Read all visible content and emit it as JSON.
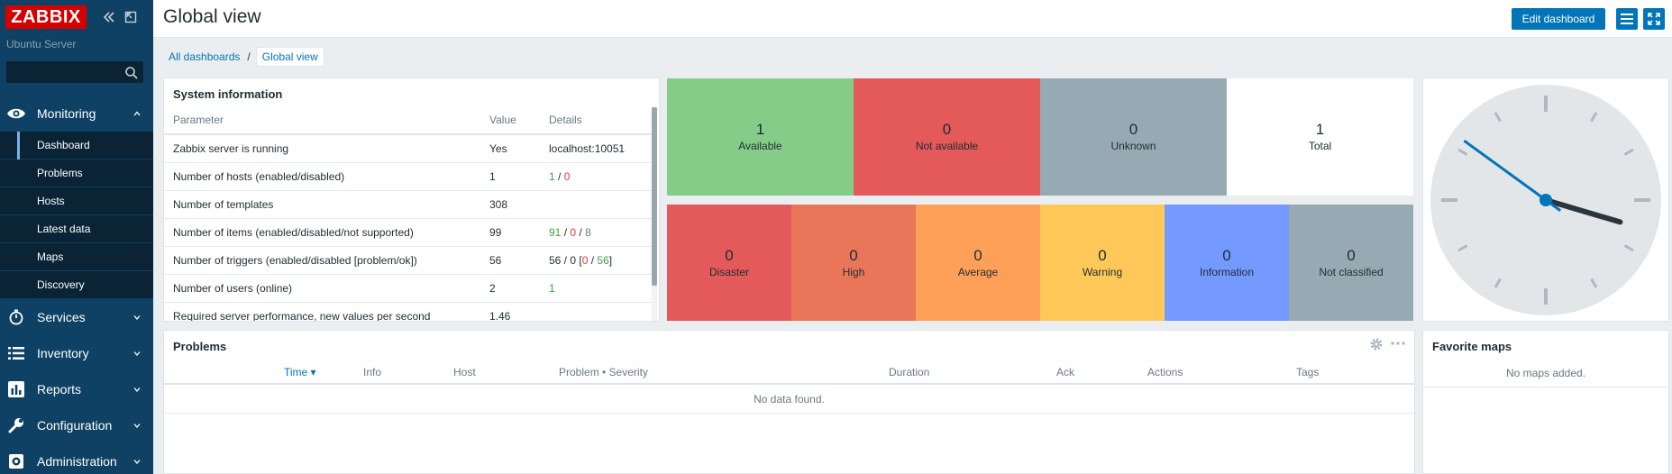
{
  "sidebar": {
    "logo": "ZABBIX",
    "server_name": "Ubuntu Server",
    "search": {
      "value": "",
      "placeholder": ""
    },
    "sections": [
      {
        "label": "Monitoring",
        "icon": "eye-icon",
        "expanded": true,
        "items": [
          {
            "label": "Dashboard",
            "selected": true
          },
          {
            "label": "Problems"
          },
          {
            "label": "Hosts"
          },
          {
            "label": "Latest data"
          },
          {
            "label": "Maps"
          },
          {
            "label": "Discovery"
          }
        ]
      },
      {
        "label": "Services",
        "icon": "stopwatch-icon"
      },
      {
        "label": "Inventory",
        "icon": "list-icon"
      },
      {
        "label": "Reports",
        "icon": "bar-chart-icon"
      },
      {
        "label": "Configuration",
        "icon": "wrench-icon"
      },
      {
        "label": "Administration",
        "icon": "gear-icon"
      }
    ]
  },
  "header": {
    "title": "Global view",
    "edit_label": "Edit dashboard"
  },
  "breadcrumb": {
    "root": "All dashboards",
    "separator": "/",
    "current": "Global view"
  },
  "system_info": {
    "title": "System information",
    "columns": [
      "Parameter",
      "Value",
      "Details"
    ],
    "rows": [
      {
        "param": "Zabbix server is running",
        "value": "Yes",
        "value_color": "green",
        "details": [
          {
            "t": "localhost:10051",
            "c": "default"
          }
        ]
      },
      {
        "param": "Number of hosts (enabled/disabled)",
        "value": "1",
        "details": [
          {
            "t": "1",
            "c": "green"
          },
          {
            "t": " / ",
            "c": "default"
          },
          {
            "t": "0",
            "c": "red"
          }
        ]
      },
      {
        "param": "Number of templates",
        "value": "308",
        "details": []
      },
      {
        "param": "Number of items (enabled/disabled/not supported)",
        "value": "99",
        "details": [
          {
            "t": "91",
            "c": "green"
          },
          {
            "t": " / ",
            "c": "default"
          },
          {
            "t": "0",
            "c": "red"
          },
          {
            "t": " / ",
            "c": "default"
          },
          {
            "t": "8",
            "c": "gray"
          }
        ]
      },
      {
        "param": "Number of triggers (enabled/disabled [problem/ok])",
        "value": "56",
        "details": [
          {
            "t": "56 / 0 [",
            "c": "default"
          },
          {
            "t": "0",
            "c": "red"
          },
          {
            "t": " / ",
            "c": "default"
          },
          {
            "t": "56",
            "c": "green"
          },
          {
            "t": "]",
            "c": "default"
          }
        ]
      },
      {
        "param": "Number of users (online)",
        "value": "2",
        "details": [
          {
            "t": "1",
            "c": "green"
          }
        ]
      },
      {
        "param": "Required server performance, new values per second",
        "value": "1.46",
        "details": []
      }
    ]
  },
  "host_availability": [
    {
      "count": "1",
      "label": "Available",
      "color": "#86cc89"
    },
    {
      "count": "0",
      "label": "Not available",
      "color": "#e45959"
    },
    {
      "count": "0",
      "label": "Unknown",
      "color": "#97aab3"
    },
    {
      "count": "1",
      "label": "Total",
      "color": "#ffffff"
    }
  ],
  "problems_by_severity": [
    {
      "count": "0",
      "label": "Disaster",
      "color": "#e45959"
    },
    {
      "count": "0",
      "label": "High",
      "color": "#e97659"
    },
    {
      "count": "0",
      "label": "Average",
      "color": "#ffa059"
    },
    {
      "count": "0",
      "label": "Warning",
      "color": "#ffc859"
    },
    {
      "count": "0",
      "label": "Information",
      "color": "#7499ff"
    },
    {
      "count": "0",
      "label": "Not classified",
      "color": "#97aab3"
    }
  ],
  "clock": {
    "hour": 3.55,
    "minute": 51
  },
  "problems": {
    "title": "Problems",
    "columns": [
      "Time ▾",
      "Info",
      "Host",
      "Problem • Severity",
      "Duration",
      "Ack",
      "Actions",
      "Tags"
    ],
    "empty": "No data found."
  },
  "favorite_maps": {
    "title": "Favorite maps",
    "empty": "No maps added."
  },
  "colors": {
    "accent": "#0275b8",
    "sidebar": "#0e4164",
    "submenu": "#0a2436",
    "logo": "#d40000"
  }
}
